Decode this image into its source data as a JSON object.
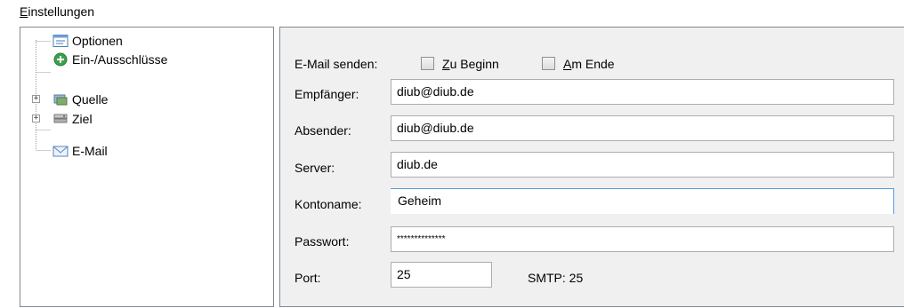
{
  "section": {
    "title": "Einstellungen"
  },
  "tree": {
    "items": [
      {
        "label": "Optionen",
        "icon": "options-window-icon"
      },
      {
        "label": "Ein-/Ausschlüsse",
        "icon": "green-plus-circle-icon"
      },
      {
        "label": "Quelle",
        "icon": "source-drive-icon",
        "expander": "+"
      },
      {
        "label": "Ziel",
        "icon": "target-drive-icon",
        "expander": "+"
      },
      {
        "label": "E-Mail",
        "icon": "envelope-icon"
      }
    ]
  },
  "email": {
    "send_label": "E-Mail senden:",
    "at_start": {
      "label": "Zu Beginn",
      "checked": false
    },
    "at_end": {
      "label": "Am Ende",
      "checked": false
    },
    "recipient": {
      "label": "Empfänger:",
      "value": "diub@diub.de"
    },
    "sender": {
      "label": "Absender:",
      "value": "diub@diub.de"
    },
    "server": {
      "label": "Server:",
      "value": "diub.de"
    },
    "account": {
      "label": "Kontoname:",
      "value": "Geheim"
    },
    "password": {
      "label": "Passwort:",
      "value": "**************"
    },
    "port": {
      "label": "Port:",
      "value": "25",
      "hint": "SMTP: 25"
    }
  },
  "colors": {
    "focus_border": "#569de5",
    "panel_bg": "#f0f0f0",
    "border": "#828790"
  }
}
